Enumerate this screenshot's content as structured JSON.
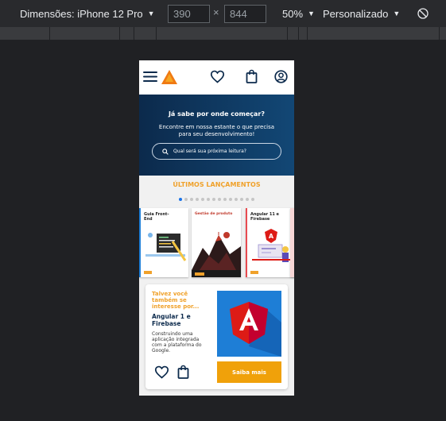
{
  "devtools": {
    "device_label": "Dimensões: iPhone 12 Pro",
    "width_value": "390",
    "height_value": "844",
    "times_symbol": "×",
    "zoom": "50%",
    "throttle": "Personalizado",
    "rotate_icon": "rotate-icon"
  },
  "site": {
    "header": {
      "menu_icon": "hamburger-menu-icon",
      "logo_icon": "triangle-logo-icon",
      "wishlist_icon": "heart-icon",
      "cart_icon": "shopping-bag-icon",
      "account_icon": "user-circle-icon"
    },
    "hero": {
      "title": "Já sabe por onde começar?",
      "subtitle": "Encontre em nossa estante o que precisa para seu desenvolvimento!",
      "search_placeholder": "Qual será sua próxima leitura?"
    },
    "releases": {
      "title": "ÚLTIMOS LANÇAMENTOS",
      "dot_count": 14,
      "active_dot": 0,
      "books": [
        {
          "title": "Guia Front-End"
        },
        {
          "title": "Gestão de produto"
        },
        {
          "title": "Angular 11 e Firebase"
        }
      ]
    },
    "suggestion": {
      "kicker": "Talvez você também se interesse por...",
      "book_title": "Angular 1 e Firebase",
      "description": "Construindo uma aplicação integrada com a plataforma do Google.",
      "cta_label": "Saiba mais",
      "wishlist_icon": "heart-icon",
      "cart_icon": "shopping-bag-icon"
    }
  },
  "colors": {
    "accent": "#f0a12a",
    "hero_dark": "#0c2a4c",
    "cta": "#f0a10a",
    "angular_red": "#dd1b16"
  }
}
